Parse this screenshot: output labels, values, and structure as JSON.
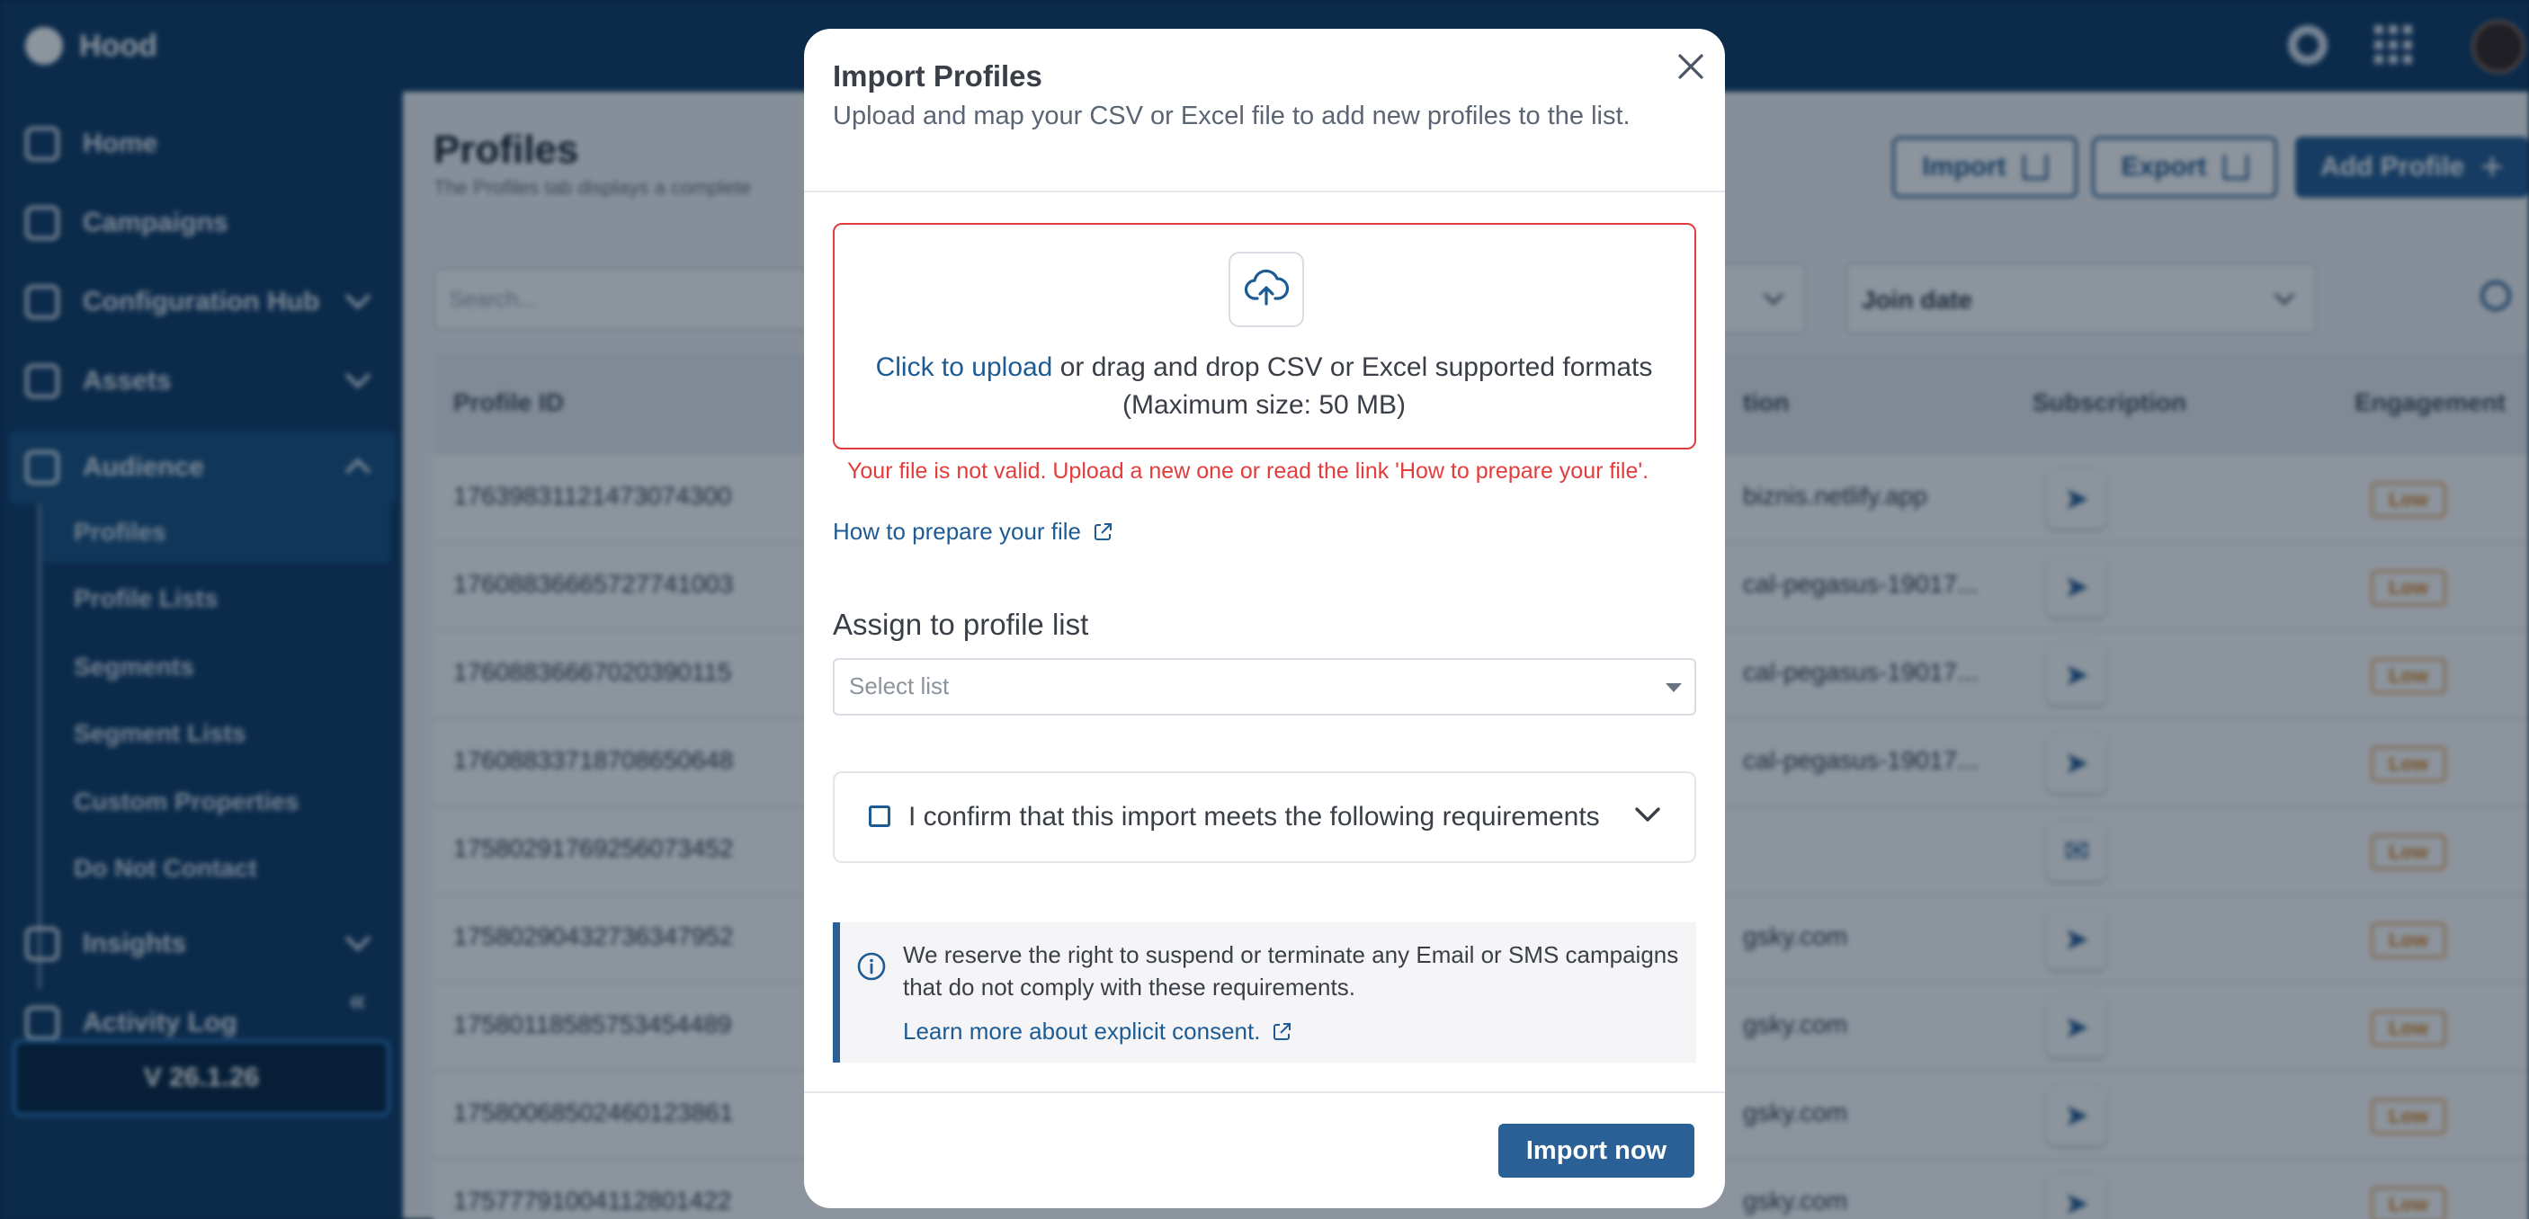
{
  "app": {
    "brand": "Hood",
    "version": "V 26.1.26"
  },
  "sidebar": {
    "items": [
      {
        "label": "Home",
        "icon": "home-icon"
      },
      {
        "label": "Campaigns",
        "icon": "campaigns-icon"
      },
      {
        "label": "Configuration Hub",
        "icon": "configuration-icon",
        "expandable": true
      },
      {
        "label": "Assets",
        "icon": "assets-icon",
        "expandable": true
      },
      {
        "label": "Audience",
        "icon": "audience-icon",
        "expanded": true
      },
      {
        "label": "Insights",
        "icon": "insights-icon",
        "expandable": true
      },
      {
        "label": "Activity Log",
        "icon": "activity-log-icon"
      }
    ],
    "audience_sub": [
      "Profiles",
      "Profile Lists",
      "Segments",
      "Segment Lists",
      "Custom Properties",
      "Do Not Contact"
    ],
    "active_sub": "Profiles"
  },
  "page": {
    "title": "Profiles",
    "description": "The Profiles tab displays a complete",
    "buttons": {
      "import": "Import",
      "export": "Export",
      "add": "Add Profile"
    },
    "search_placeholder": "Search...",
    "filter_join_date": "Join date",
    "columns": {
      "profile_id": "Profile ID",
      "location": "tion",
      "subscription": "Subscription",
      "engagement": "Engagement"
    },
    "rows": [
      {
        "id": "1763983112147307430​0",
        "loc": "biznis.netlify.app",
        "channel": "sms",
        "engagement": "Low"
      },
      {
        "id": "1760883666572774100​3",
        "loc": "cal-pegasus-19017...",
        "channel": "sms",
        "engagement": "Low"
      },
      {
        "id": "1760883666702039011​5",
        "loc": "cal-pegasus-19017...",
        "channel": "sms",
        "engagement": "Low"
      },
      {
        "id": "1760883371870865064​8",
        "loc": "cal-pegasus-19017...",
        "channel": "sms",
        "engagement": "Low"
      },
      {
        "id": "1758029176925607345​2",
        "loc": "",
        "channel": "email",
        "engagement": "Low"
      },
      {
        "id": "1758029043273634795​2",
        "loc": "gsky.com",
        "channel": "sms",
        "engagement": "Low"
      },
      {
        "id": "1758011858575345448​9",
        "loc": "gsky.com",
        "channel": "sms",
        "engagement": "Low"
      },
      {
        "id": "1758006850246012386​1",
        "loc": "gsky.com",
        "channel": "sms",
        "engagement": "Low"
      },
      {
        "id": "1757779100411280142​2",
        "loc": "gsky.com",
        "channel": "sms",
        "engagement": "Low"
      }
    ]
  },
  "modal": {
    "title": "Import Profiles",
    "subtitle": "Upload and map your CSV or Excel file to add new profiles to the list.",
    "upload": {
      "link": "Click to upload",
      "text": " or drag and drop CSV or Excel supported formats",
      "max": "(Maximum size: 50 MB)"
    },
    "error": "Your file is not valid. Upload a new one or read the link 'How to prepare your file'.",
    "how_link": "How to prepare your file",
    "assign_label": "Assign to profile list",
    "assign_placeholder": "Select list",
    "confirm_label": "I confirm that this import meets the following requirements",
    "notice": "We reserve the right to suspend or terminate any Email or SMS campaigns that do not comply with these requirements.",
    "notice_link": "Learn more about explicit consent.",
    "submit": "Import now"
  },
  "colors": {
    "primary": "#2a6095",
    "link": "#1d5b94",
    "error": "#e33c3c",
    "sidebar": "#16406a"
  }
}
